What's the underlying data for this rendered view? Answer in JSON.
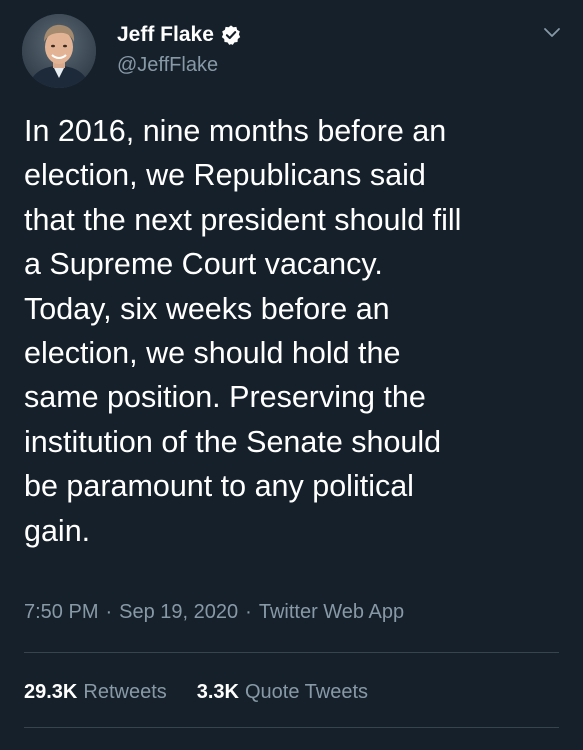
{
  "author": {
    "display_name": "Jeff Flake",
    "handle": "@JeffFlake",
    "verified": true,
    "verified_icon": "verified-badge-icon",
    "avatar_icon": "profile-photo"
  },
  "tweet": {
    "text": "In 2016, nine months before an\nelection, we Republicans said\nthat the next president should fill\na Supreme Court vacancy.\nToday, six weeks before an\nelection, we should hold the\nsame position. Preserving the\ninstitution of the Senate should\nbe paramount to any political\ngain.",
    "time": "7:50 PM",
    "separator": "·",
    "date": "Sep 19, 2020",
    "source": "Twitter Web App"
  },
  "stats": {
    "retweets_count": "29.3K",
    "retweets_label": "Retweets",
    "quotes_count": "3.3K",
    "quotes_label": "Quote Tweets"
  },
  "colors": {
    "background": "#15202b",
    "secondary_text": "#8899a6",
    "divider": "#38444d",
    "primary_text": "#ffffff"
  }
}
